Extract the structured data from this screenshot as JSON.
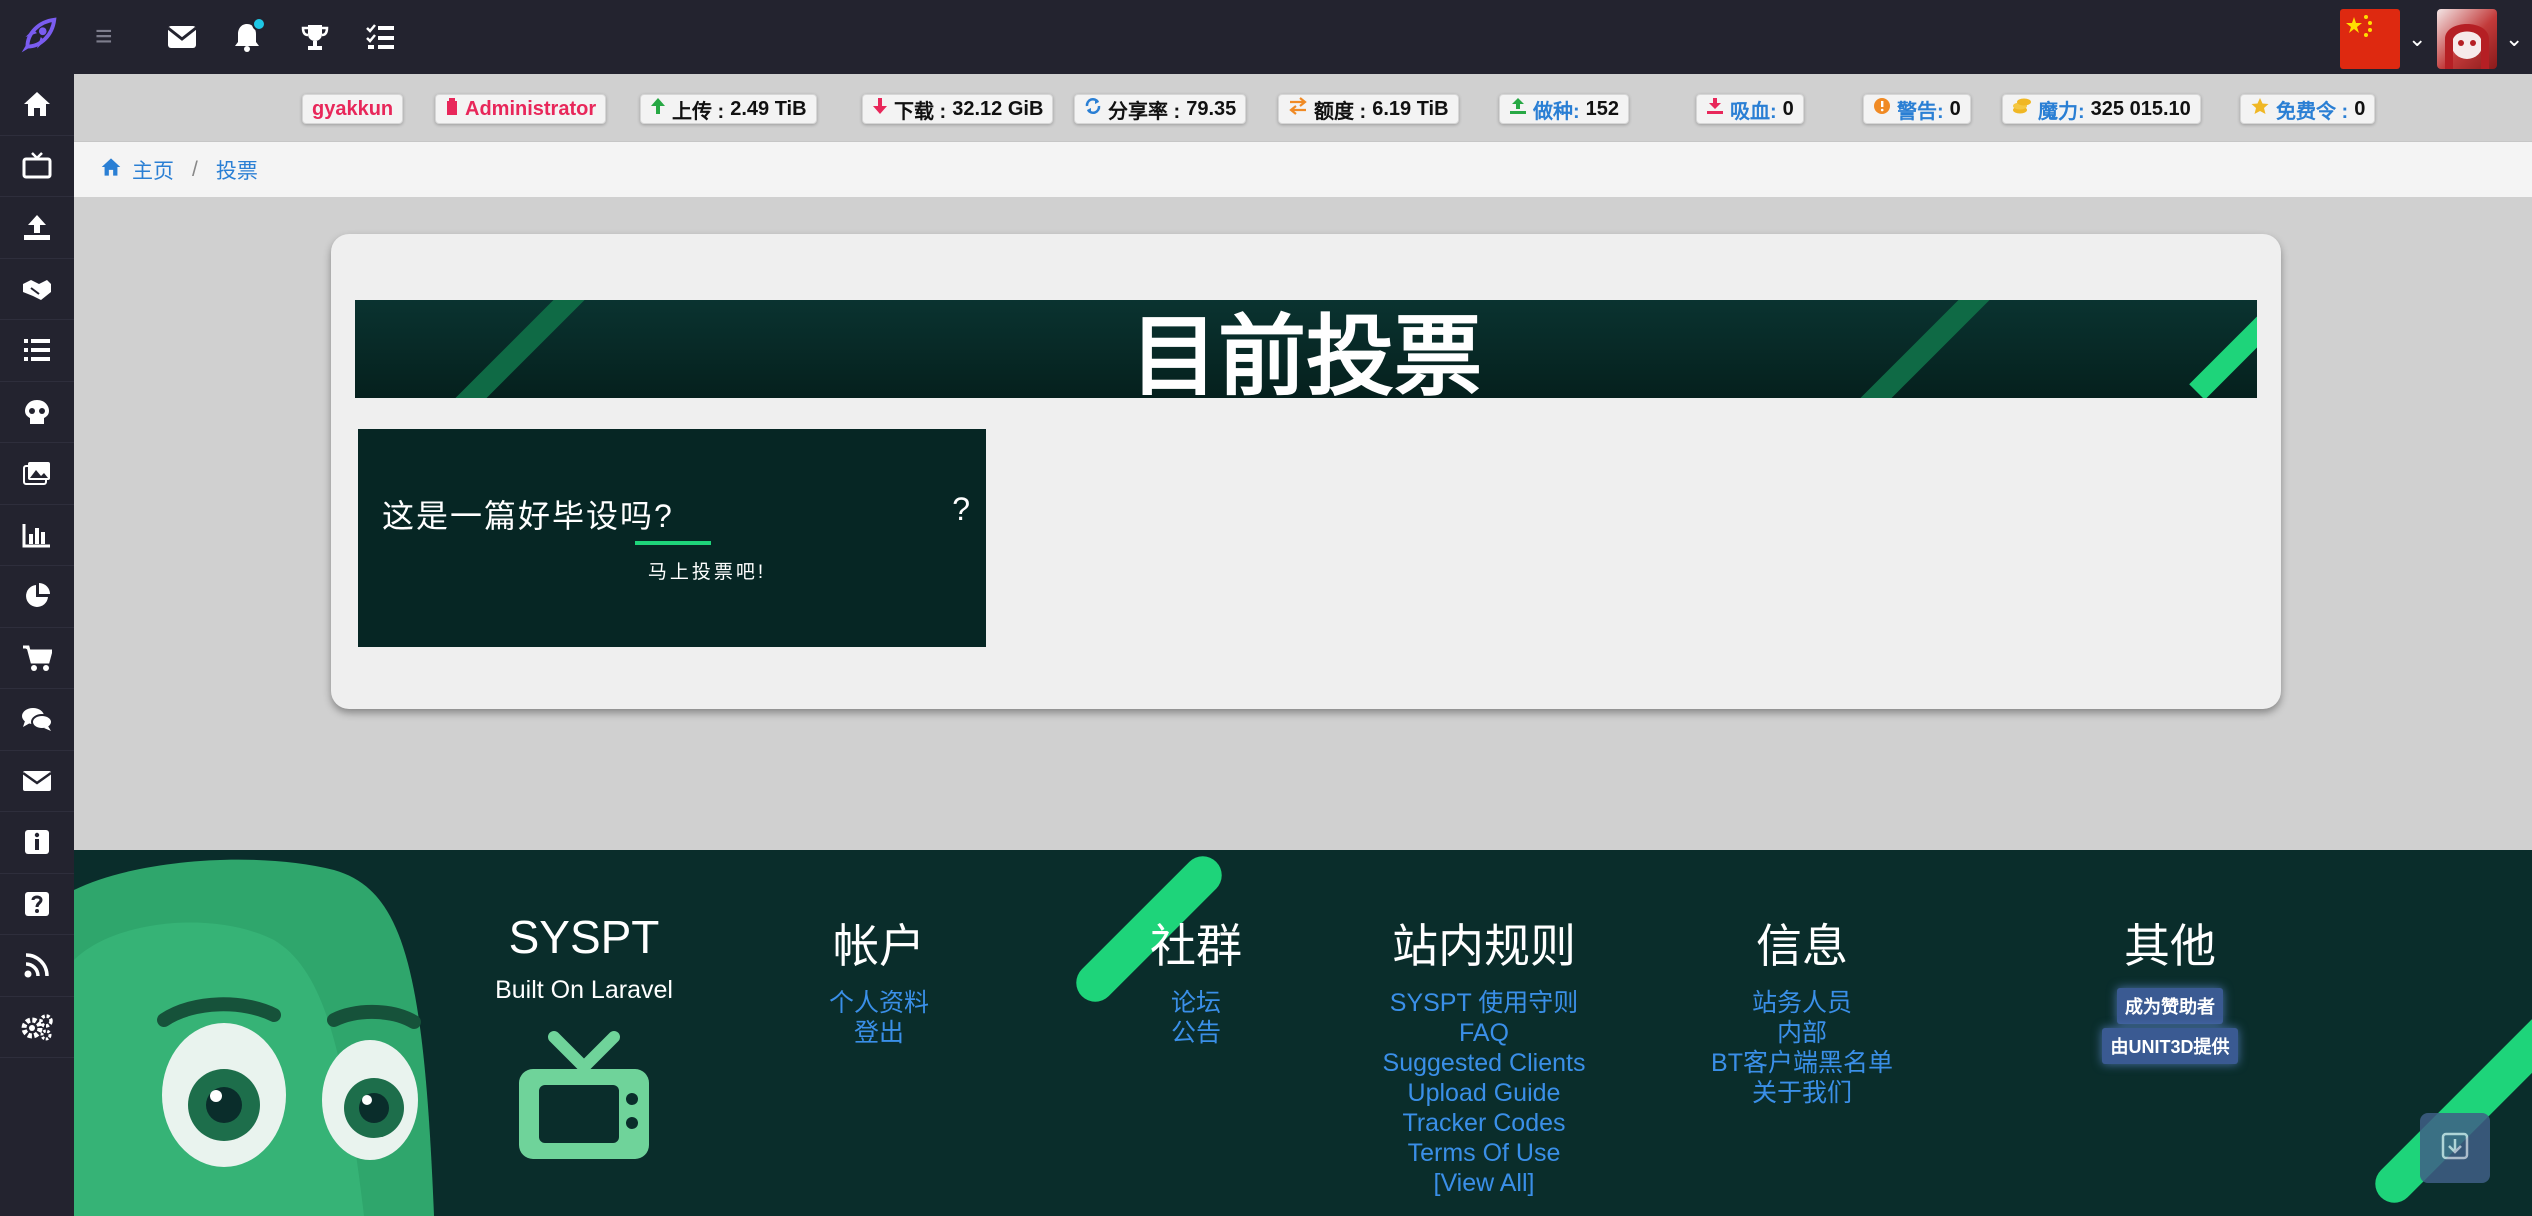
{
  "topbar": {
    "icons": [
      "rocket-logo-icon",
      "hamburger-icon",
      "envelope-icon",
      "bell-icon",
      "trophy-icon",
      "tasks-icon"
    ],
    "flag_color": "#de2910"
  },
  "sidebar": {
    "items": [
      "home-icon",
      "tv-icon",
      "upload-icon",
      "handshake-icon",
      "list-icon",
      "skull-icon",
      "images-icon",
      "chart-bar-icon",
      "chart-pie-icon",
      "cart-icon",
      "comments-icon",
      "envelope-icon",
      "info-icon",
      "question-icon",
      "rss-icon",
      "cogs-icon"
    ]
  },
  "stats": {
    "username": "gyakkun",
    "group": "Administrator",
    "upload_label": "上传 : ",
    "upload_value": "2.49 TiB",
    "download_label": "下载 : ",
    "download_value": "32.12 GiB",
    "ratio_label": "分享率 : ",
    "ratio_value": "79.35",
    "buffer_label": "额度 : ",
    "buffer_value": "6.19 TiB",
    "seeding_label": "做种:",
    "seeding_value": "152",
    "leeching_label": "吸血:",
    "leeching_value": "0",
    "warnings_label": "警告:",
    "warnings_value": "0",
    "bonus_label": "魔力:",
    "bonus_value": "325 015.10",
    "tokens_label": "免费令 : ",
    "tokens_value": "0"
  },
  "breadcrumb": {
    "home": "主页",
    "current": "投票"
  },
  "main": {
    "banner_title": "目前投票",
    "poll": {
      "question": "这是一篇好毕设吗?",
      "mark": "?",
      "cta": "马上投票吧!"
    }
  },
  "footer": {
    "site": {
      "title": "SYSPT",
      "subtitle": "Built On Laravel"
    },
    "account": {
      "title": "帐户",
      "links": [
        "个人资料",
        "登出"
      ]
    },
    "community": {
      "title": "社群",
      "links": [
        "论坛",
        "公告"
      ]
    },
    "rules": {
      "title": "站内规则",
      "links": [
        "SYSPT 使用守则",
        "FAQ",
        "Suggested Clients",
        "Upload Guide",
        "Tracker Codes",
        "Terms Of Use",
        "[View All]"
      ]
    },
    "info": {
      "title": "信息",
      "links": [
        "站务人员",
        "内部",
        "BT客户端黑名单",
        "关于我们"
      ]
    },
    "other": {
      "title": "其他",
      "tags": [
        "成为赞助者",
        "由UNIT3D提供"
      ]
    }
  },
  "colors": {
    "accent_green": "#1ed47a",
    "link_blue": "#2a7fd4",
    "pink": "#e8275a",
    "dark_bg": "#23232f",
    "footer_bg": "#0a2d2b"
  }
}
